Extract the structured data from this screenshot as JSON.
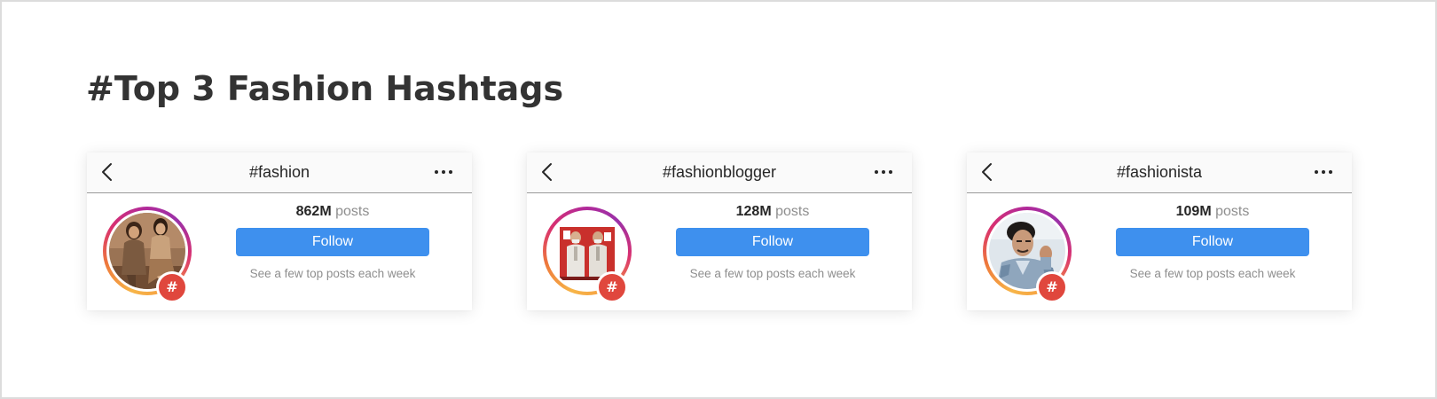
{
  "page": {
    "title": "#Top 3 Fashion Hashtags"
  },
  "colors": {
    "follow_button": "#3e90ee",
    "hash_badge": "#e0473d",
    "ring_gradient": [
      "#f7b548",
      "#ee7a3b",
      "#d9306f",
      "#b32a98"
    ]
  },
  "cards": [
    {
      "hashtag": "#fashion",
      "posts_count": "862M",
      "posts_label": "posts",
      "follow_label": "Follow",
      "caption": "See a few top posts each week",
      "back_icon": "chevron-left-icon",
      "more_icon": "more-horizontal-icon",
      "badge_glyph": "#",
      "image": "two-women-fashion-photo"
    },
    {
      "hashtag": "#fashionblogger",
      "posts_count": "128M",
      "posts_label": "posts",
      "follow_label": "Follow",
      "caption": "See a few top posts each week",
      "back_icon": "chevron-left-icon",
      "more_icon": "more-horizontal-icon",
      "badge_glyph": "#",
      "image": "two-men-suits-photo"
    },
    {
      "hashtag": "#fashionista",
      "posts_count": "109M",
      "posts_label": "posts",
      "follow_label": "Follow",
      "caption": "See a few top posts each week",
      "back_icon": "chevron-left-icon",
      "more_icon": "more-horizontal-icon",
      "badge_glyph": "#",
      "image": "man-denim-jacket-photo"
    }
  ]
}
